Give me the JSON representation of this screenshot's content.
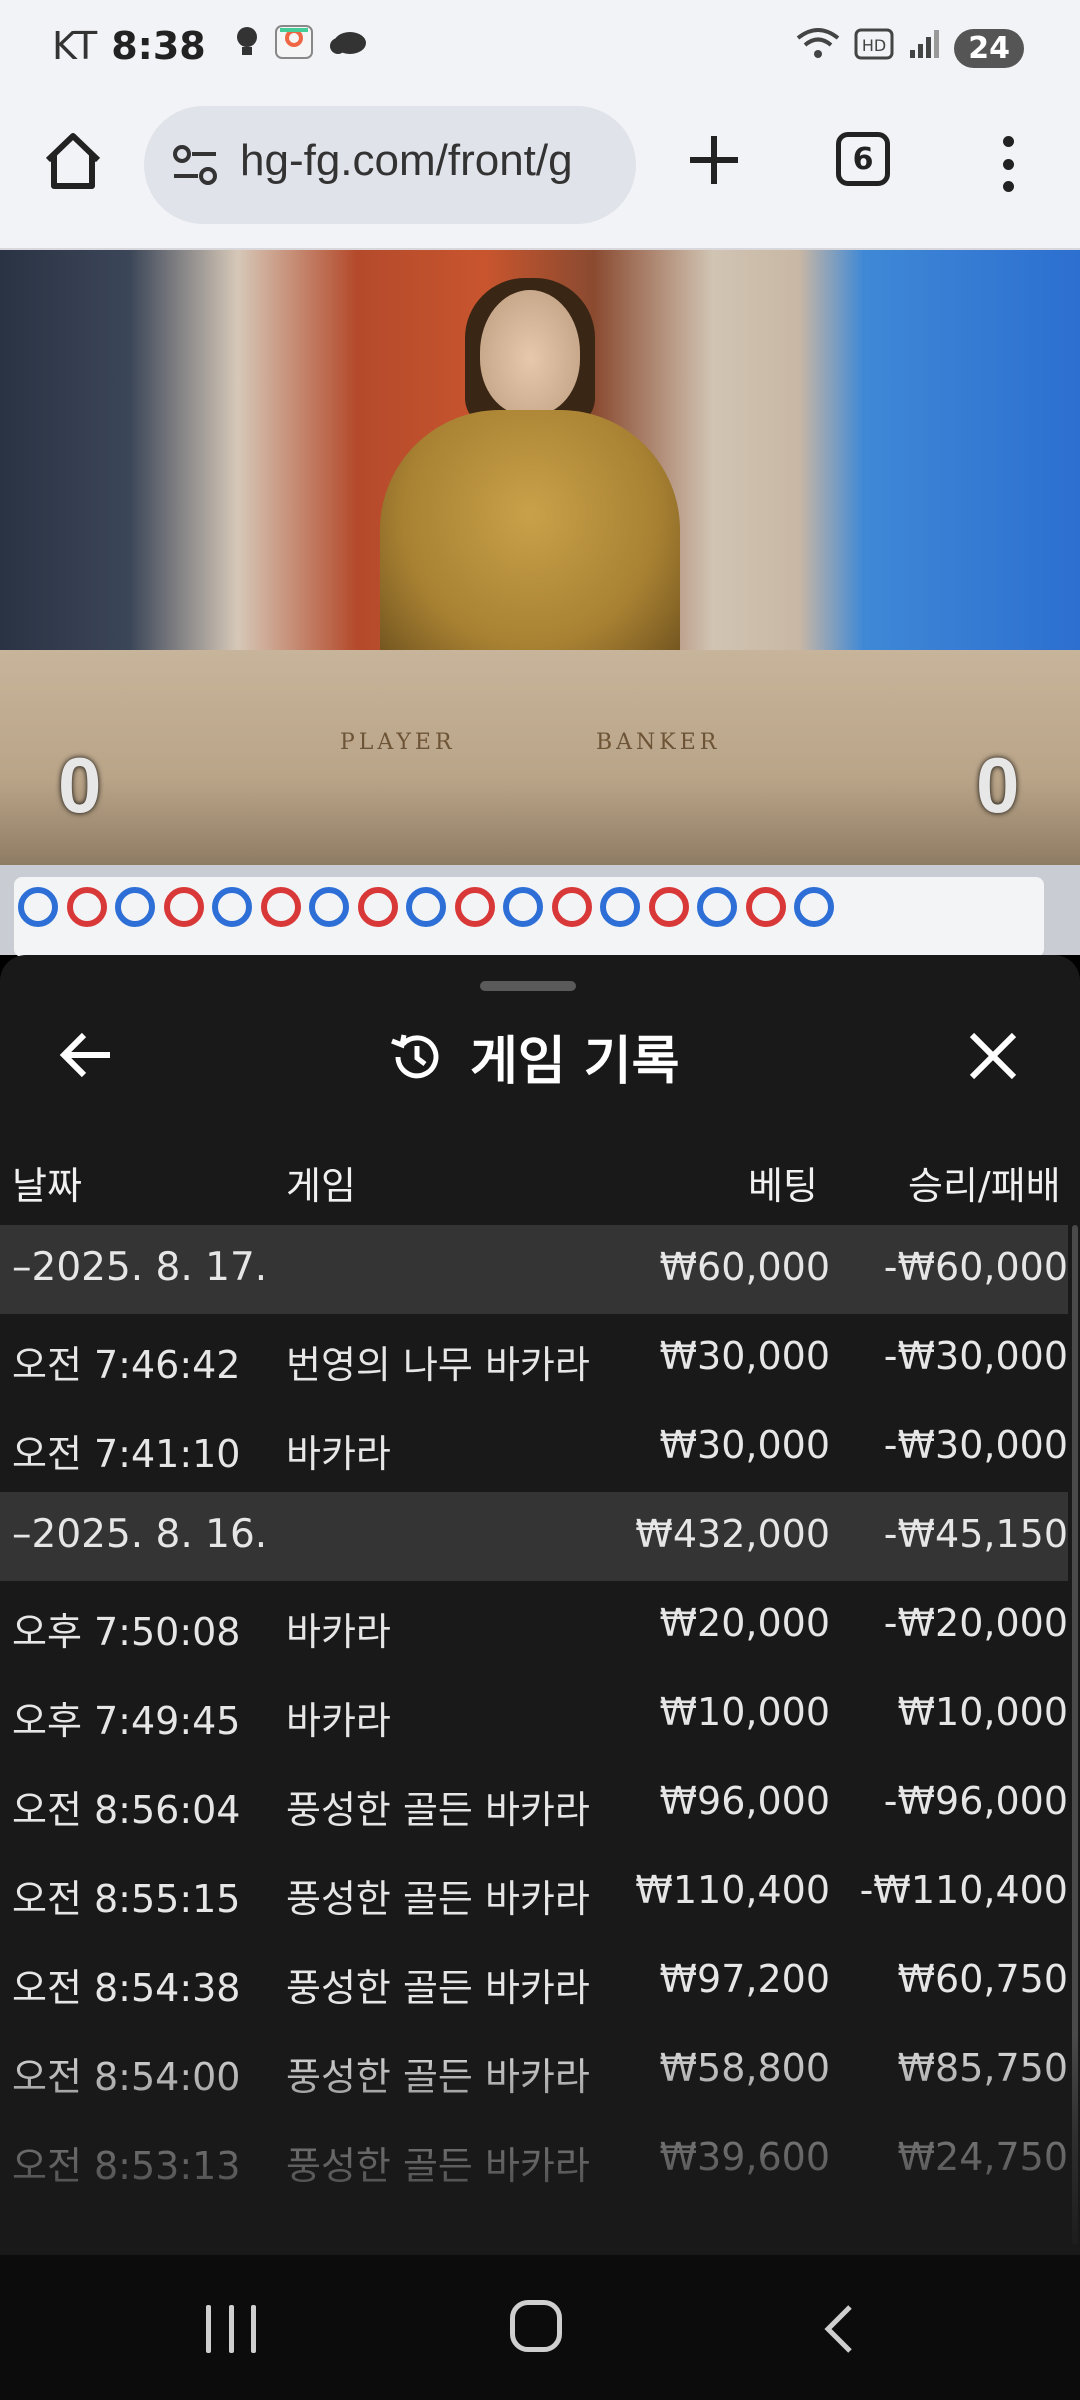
{
  "status_bar": {
    "carrier": "KT",
    "time": "8:38",
    "battery": "24"
  },
  "browser": {
    "url": "hg-fg.com/front/g",
    "tab_count": "6"
  },
  "video": {
    "table_player_label": "PLAYER",
    "table_banker_label": "BANKER",
    "player_score": "0",
    "banker_score": "0"
  },
  "panel": {
    "title": "게임 기록",
    "columns": {
      "date": "날짜",
      "game": "게임",
      "bet": "베팅",
      "win_loss": "승리/패배"
    },
    "rows": [
      {
        "type": "group",
        "date": "–2025. 8. 17.",
        "game": "",
        "bet": "₩60,000",
        "result": "-₩60,000"
      },
      {
        "type": "item",
        "date": "오전 7:46:42",
        "game": "번영의 나무 바카라",
        "bet": "₩30,000",
        "result": "-₩30,000"
      },
      {
        "type": "item",
        "date": "오전 7:41:10",
        "game": "바카라",
        "bet": "₩30,000",
        "result": "-₩30,000"
      },
      {
        "type": "group",
        "date": "–2025. 8. 16.",
        "game": "",
        "bet": "₩432,000",
        "result": "-₩45,150"
      },
      {
        "type": "item",
        "date": "오후 7:50:08",
        "game": "바카라",
        "bet": "₩20,000",
        "result": "-₩20,000"
      },
      {
        "type": "item",
        "date": "오후 7:49:45",
        "game": "바카라",
        "bet": "₩10,000",
        "result": "₩10,000"
      },
      {
        "type": "item",
        "date": "오전 8:56:04",
        "game": "풍성한 골든 바카라",
        "bet": "₩96,000",
        "result": "-₩96,000"
      },
      {
        "type": "item",
        "date": "오전 8:55:15",
        "game": "풍성한 골든 바카라",
        "bet": "₩110,400",
        "result": "-₩110,400"
      },
      {
        "type": "item",
        "date": "오전 8:54:38",
        "game": "풍성한 골든 바카라",
        "bet": "₩97,200",
        "result": "₩60,750"
      },
      {
        "type": "item",
        "date": "오전 8:54:00",
        "game": "풍성한 골든 바카라",
        "bet": "₩58,800",
        "result": "₩85,750"
      },
      {
        "type": "item",
        "date": "오전 8:53:13",
        "game": "풍성한 골든 바카라",
        "bet": "₩39,600",
        "result": "₩24,750"
      }
    ]
  },
  "road_beads": [
    "P",
    "B",
    "P",
    "B",
    "P",
    "B",
    "P",
    "B",
    "P",
    "B",
    "P",
    "B",
    "P",
    "B",
    "P",
    "B",
    "P"
  ]
}
